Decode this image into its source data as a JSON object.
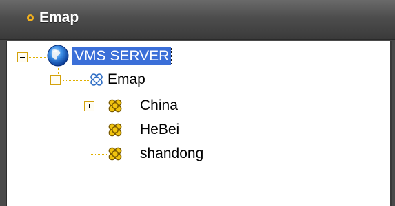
{
  "panel": {
    "title": "Emap"
  },
  "tree": {
    "root": {
      "label": "VMS SERVER",
      "icon": "globe-icon",
      "expanded": true,
      "selected": true
    },
    "emap": {
      "label": "Emap",
      "icon": "emap-node-icon",
      "expanded": true
    },
    "children": [
      {
        "label": "China",
        "icon": "map-node-icon",
        "expandable": true,
        "expanded": false
      },
      {
        "label": "HeBei",
        "icon": "map-node-icon",
        "expandable": false
      },
      {
        "label": "shandong",
        "icon": "map-node-icon",
        "expandable": false
      }
    ]
  },
  "colors": {
    "title_bar": "#4d4d4d",
    "title_bullet": "#f2b01e",
    "selection": "#3b6fd8",
    "tree_lines": "#e0b000",
    "map_node": "#e8b400",
    "emap_node": "#3d7ccf"
  }
}
